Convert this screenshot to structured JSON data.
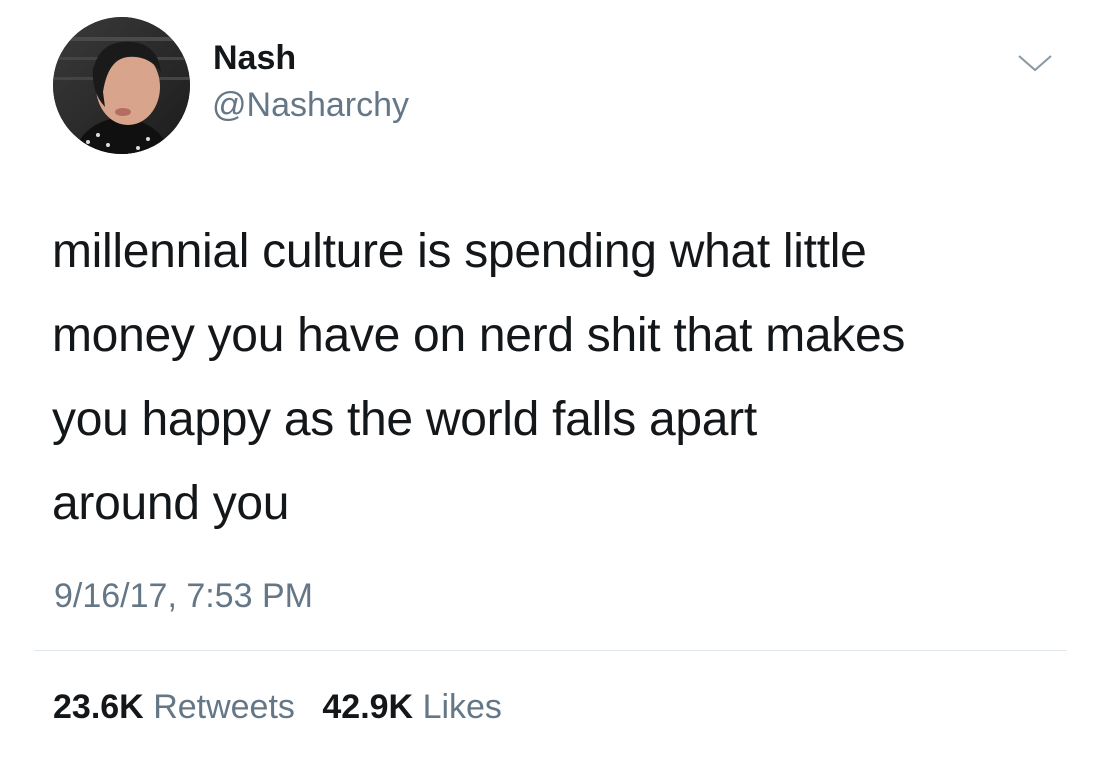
{
  "author": {
    "name": "Nash",
    "handle": "@Nasharchy"
  },
  "tweet": {
    "text": "millennial culture is spending what little money you have on nerd shit that makes you happy as the world falls apart around you",
    "lines": [
      "millennial culture is spending what little",
      "money you have on nerd shit that makes",
      "you happy as the world falls apart",
      "around you"
    ],
    "timestamp": "9/16/17, 7:53 PM"
  },
  "stats": {
    "retweets_count": "23.6K",
    "retweets_label": "Retweets",
    "likes_count": "42.9K",
    "likes_label": "Likes"
  },
  "icons": {
    "menu": "chevron-down-icon"
  },
  "colors": {
    "text": "#14171a",
    "secondary": "#657786",
    "divider": "#e1e8ed",
    "background": "#ffffff"
  }
}
